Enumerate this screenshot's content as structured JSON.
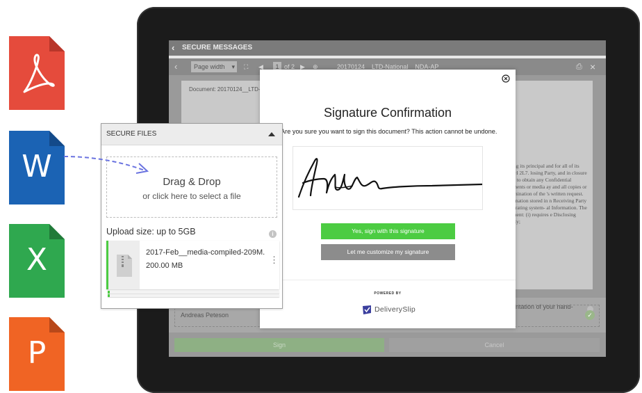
{
  "file_icons": [
    {
      "name": "pdf",
      "label": "",
      "color": "#e54b3c"
    },
    {
      "name": "word",
      "label": "W",
      "color": "#1b63b4"
    },
    {
      "name": "excel",
      "label": "X",
      "color": "#2fa84f"
    },
    {
      "name": "powerpoint",
      "label": "P",
      "color": "#f06424"
    }
  ],
  "app": {
    "header_title": "SECURE MESSAGES",
    "toolbar": {
      "page_width": "Page width",
      "page_current": "1",
      "page_of": "of 2",
      "doc_title": "20170124__LTD-National__NDA-AP"
    },
    "document": {
      "name": "Document: 20170124__LTD-N",
      "body_text": "iving its principal and for all of its V8H 2L7. losing Party, and in closure and to obtain any Confidential cuments or media ay and all copies or termination of the 's written request. formation stored in n Receiving Party operating system- al Information. The eement: (i) requires e Disclosing Party;"
    },
    "signature_note": "entation of your hand-",
    "signer_name": "Andreas Peteson",
    "sign_button": "Sign",
    "cancel_button": "Cancel"
  },
  "modal": {
    "title": "Signature Confirmation",
    "question": "Are you sure you want to sign this document? This action cannot be undone.",
    "confirm_button": "Yes, sign with this signature",
    "customize_button": "Let me customize my signature",
    "powered_by": "POWERED BY",
    "brand": "DeliverySlip"
  },
  "secure_files": {
    "title": "SECURE FILES",
    "drop_title": "Drag & Drop",
    "drop_subtitle": "or click here to select a file",
    "upload_size": "Upload size: up to 5GB",
    "file": {
      "name": "2017-Feb__media-compiled-209M.",
      "size": "200.00 MB"
    }
  },
  "colors": {
    "accent_green": "#4ccc42",
    "drag_arrow": "#6a73e0"
  }
}
